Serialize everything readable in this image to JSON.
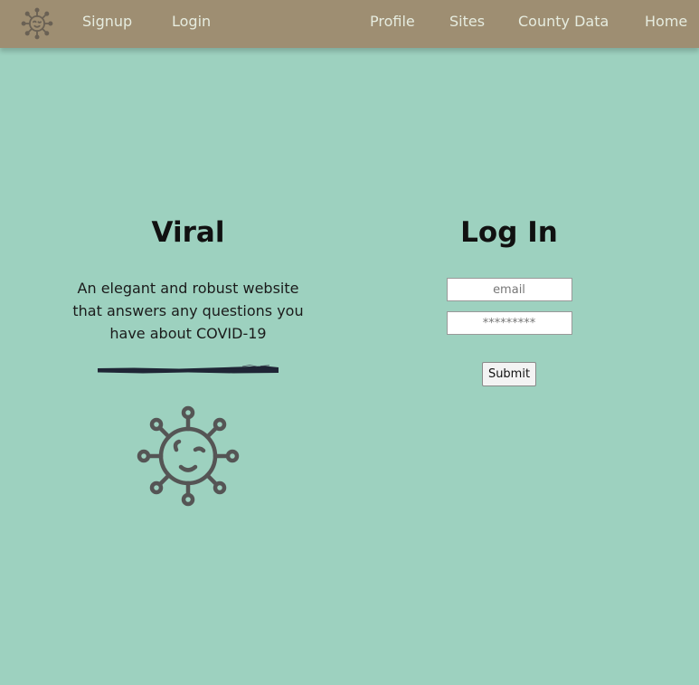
{
  "nav": {
    "logo_icon": "virus-logo-icon",
    "signup": "Signup",
    "login": "Login",
    "profile": "Profile",
    "sites": "Sites",
    "county_data": "County Data",
    "home": "Home"
  },
  "hero": {
    "title": "Viral",
    "tagline": "An elegant and robust website that answers any questions you have about COVID-19",
    "divider_icon": "brush-stroke-divider",
    "illustration_icon": "smiling-virus-icon"
  },
  "login_form": {
    "title": "Log In",
    "email_placeholder": "email",
    "password_placeholder": "*********",
    "submit_label": "Submit"
  },
  "colors": {
    "background": "#9dd1bf",
    "navbar": "#9e8e72",
    "nav_text": "#e6ecdf",
    "virus_stroke": "#555555"
  }
}
